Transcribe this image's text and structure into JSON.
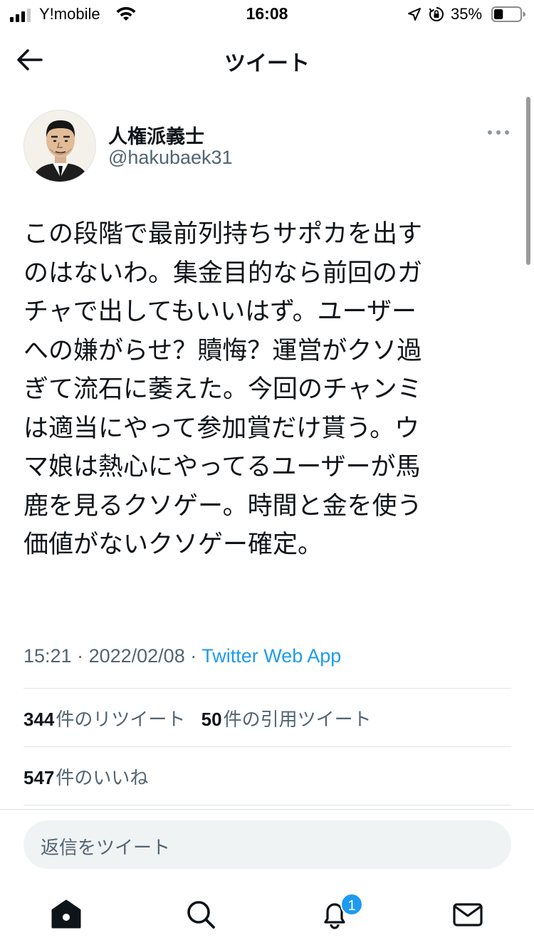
{
  "status_bar": {
    "carrier": "Y!mobile",
    "time": "16:08",
    "battery_percent": "35%",
    "battery_level": 0.35,
    "icons": [
      "signal-icon",
      "wifi-icon",
      "location-icon",
      "orientation-lock-icon",
      "battery-icon"
    ]
  },
  "header": {
    "title": "ツイート",
    "back_icon": "arrow-left-icon"
  },
  "tweet": {
    "author_name": "人権派義士",
    "author_handle": "@hakubaek31",
    "more_icon": "more-horizontal-icon",
    "lines": [
      "この段階で最前列持ちサポカを出す",
      "のはないわ。集金目的なら前回のガ",
      "チャで出してもいいはず。ユーザー",
      "への嫌がらせ？贖悔？運営がクソ過",
      "ぎて流石に萎えた。今回のチャンミ",
      "は適当にやって参加賞だけ貰う。ウ",
      "マ娘は熱心にやってるユーザーが馬",
      "鹿を見るクソゲー。時間と金を使う",
      "価値がないクソゲー確定。"
    ],
    "time": "15:21",
    "date": "2022/02/08",
    "separator": " · ",
    "source": "Twitter Web App"
  },
  "stats": {
    "retweets_count": "344",
    "retweets_label": "件のリツイート",
    "quotes_count": "50",
    "quotes_label": "件の引用ツイート",
    "likes_count": "547",
    "likes_label": "件のいいね"
  },
  "reply": {
    "placeholder": "返信をツイート"
  },
  "tab_bar": {
    "tabs": [
      "home-icon",
      "search-icon",
      "notifications-icon",
      "messages-icon"
    ],
    "notification_badge": "1"
  },
  "colors": {
    "accent": "#1d9bf0",
    "text_primary": "#0f1419",
    "text_secondary": "#536471",
    "reply_background": "#eff3f4"
  }
}
